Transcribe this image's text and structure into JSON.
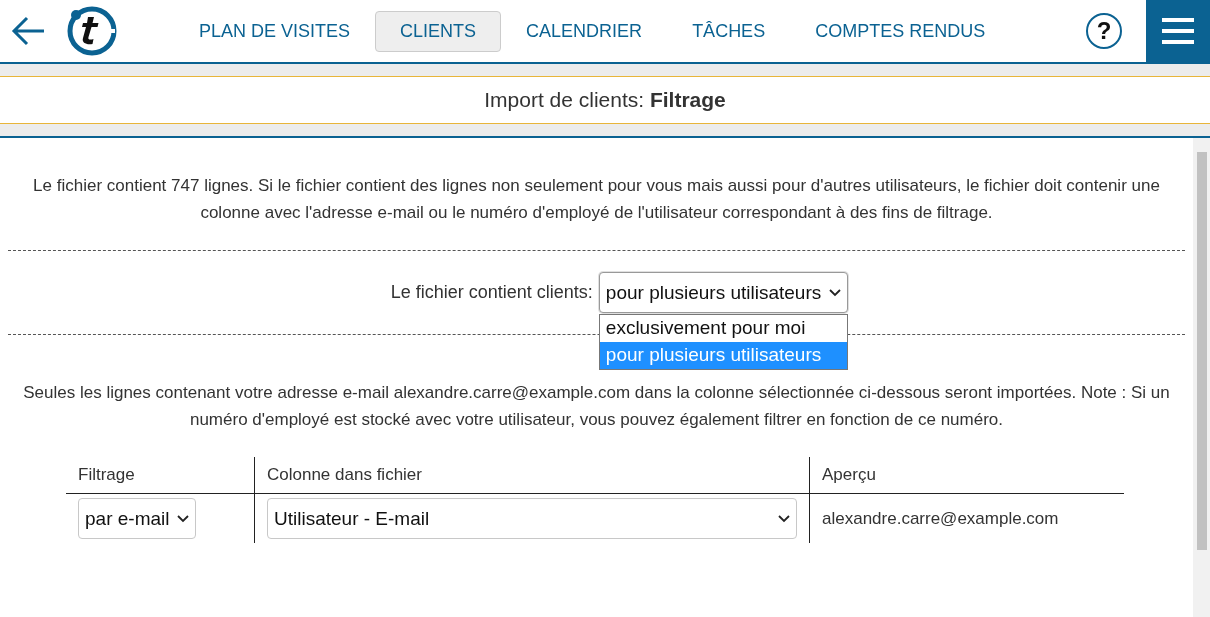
{
  "nav": {
    "items": [
      {
        "label": "PLAN DE VISITES",
        "selected": false
      },
      {
        "label": "CLIENTS",
        "selected": true
      },
      {
        "label": "CALENDRIER",
        "selected": false
      },
      {
        "label": "TÂCHES",
        "selected": false
      },
      {
        "label": "COMPTES RENDUS",
        "selected": false
      }
    ],
    "help": "?"
  },
  "page_title": "Import de clients: **Filtrage**",
  "intro": "Le fichier contient 747 lignes. Si le fichier contient des lignes non seulement pour vous mais aussi pour d'autres utilisateurs, le fichier doit contenir une colonne avec l'adresse e-mail ou le numéro d'employé de l'utilisateur correspondant à des fins de filtrage.",
  "file_scope": {
    "label": "Le fichier contient clients:",
    "value": "pour plusieurs utilisateurs",
    "expanded": true,
    "options": [
      {
        "label": "exclusivement pour moi",
        "selected": false
      },
      {
        "label": "pour plusieurs utilisateurs",
        "selected": true
      }
    ]
  },
  "note": "Seules les lignes contenant votre adresse e-mail alexandre.carre@example.com dans la colonne sélectionnée ci-dessous seront importées. Note : Si un numéro d'employé est stocké avec votre utilisateur, vous pouvez également filtrer en fonction de ce numéro.",
  "table": {
    "columns": [
      "Filtrage",
      "Colonne dans fichier",
      "Aperçu"
    ],
    "rows": [
      {
        "filter": "par e-mail",
        "column": "Utilisateur - E-mail",
        "preview": "alexandre.carre@example.com"
      }
    ]
  }
}
